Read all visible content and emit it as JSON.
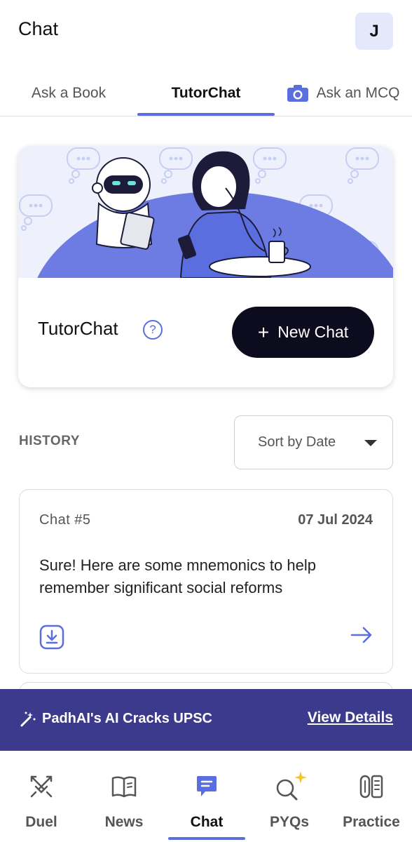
{
  "header": {
    "title": "Chat",
    "avatar_initial": "J"
  },
  "tabs": [
    {
      "label": "Ask a Book"
    },
    {
      "label": "TutorChat"
    },
    {
      "label": "Ask an MCQ"
    }
  ],
  "hero": {
    "title": "TutorChat",
    "help_icon": "?",
    "new_chat_plus": "+",
    "new_chat_label": "New Chat"
  },
  "history": {
    "label": "HISTORY",
    "sort_label": "Sort by Date",
    "items": [
      {
        "title": "Chat  #5",
        "date": "07 Jul 2024",
        "preview": "Sure! Here are some mnemonics to help remember significant social reforms"
      }
    ]
  },
  "promo": {
    "text": "PadhAI's AI Cracks UPSC",
    "link": "View Details"
  },
  "nav": [
    {
      "label": "Duel",
      "icon": "swords-icon"
    },
    {
      "label": "News",
      "icon": "book-icon"
    },
    {
      "label": "Chat",
      "icon": "chat-bubble-icon"
    },
    {
      "label": "PYQs",
      "icon": "search-sparkle-icon"
    },
    {
      "label": "Practice",
      "icon": "practice-icon"
    }
  ],
  "colors": {
    "accent": "#5a6ee0",
    "dark_button": "#0d0b1e",
    "promo_bg": "#3b3a8c",
    "avatar_bg": "#e3e8fb"
  }
}
